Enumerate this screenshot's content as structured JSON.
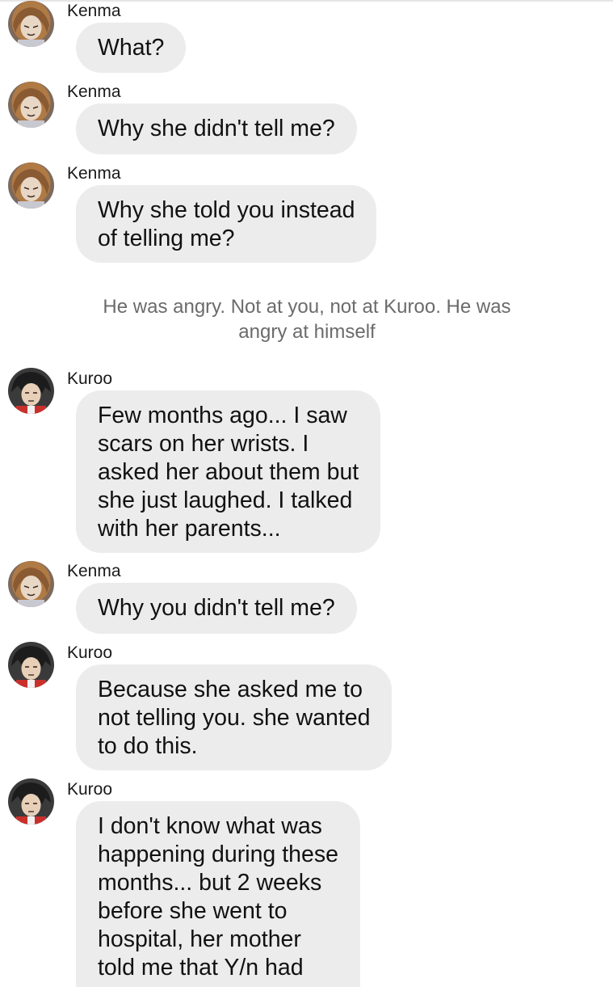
{
  "conversation": {
    "messages": [
      {
        "sender": "Kenma",
        "avatar": "kenma-avatar",
        "text": "What?"
      },
      {
        "sender": "Kenma",
        "avatar": "kenma-avatar",
        "text": "Why she didn't tell me?"
      },
      {
        "sender": "Kenma",
        "avatar": "kenma-avatar",
        "text": "Why she told you instead\nof telling me?"
      },
      {
        "sender": "Kuroo",
        "avatar": "kuroo-avatar",
        "text": "Few months ago... I saw\nscars on her wrists. I\nasked her about them but\nshe just laughed. I talked\nwith her parents..."
      },
      {
        "sender": "Kenma",
        "avatar": "kenma-avatar",
        "text": "Why you didn't tell me?"
      },
      {
        "sender": "Kuroo",
        "avatar": "kuroo-avatar",
        "text": "Because she asked me to\nnot telling you. she wanted\nto do this."
      },
      {
        "sender": "Kuroo",
        "avatar": "kuroo-avatar",
        "text": "I don't know what was\nhappening during these\nmonths... but 2 weeks\nbefore she went to\nhospital, her mother\ntold me that Y/n had"
      }
    ],
    "narration": "He was angry. Not at you, not at Kuroo. He was\nangry at himself"
  },
  "colors": {
    "bubble": "#ececec",
    "narration_text": "#6b6b6b",
    "kenma_hair": "#b07a45",
    "kuroo_hair": "#1c1c1c"
  }
}
